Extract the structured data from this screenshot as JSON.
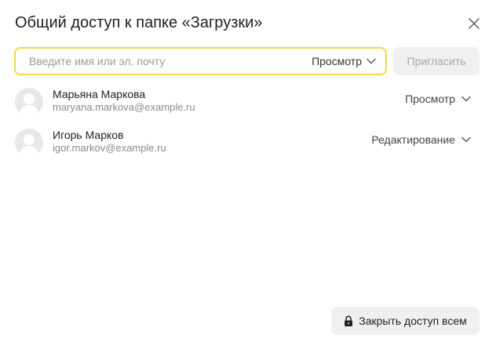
{
  "dialog": {
    "title": "Общий доступ к папке «Загрузки»",
    "close_icon": "close-icon"
  },
  "invite": {
    "placeholder": "Введите имя или эл. почту",
    "value": "",
    "role": "Просмотр",
    "button_label": "Пригласить",
    "border_color": "#f5d64c"
  },
  "users": [
    {
      "name": "Марьяна Маркова",
      "email": "maryana.markova@example.ru",
      "role": "Просмотр"
    },
    {
      "name": "Игорь Марков",
      "email": "igor.markov@example.ru",
      "role": "Редактирование"
    }
  ],
  "footer": {
    "revoke_label": "Закрыть доступ всем",
    "revoke_icon": "lock-icon"
  }
}
